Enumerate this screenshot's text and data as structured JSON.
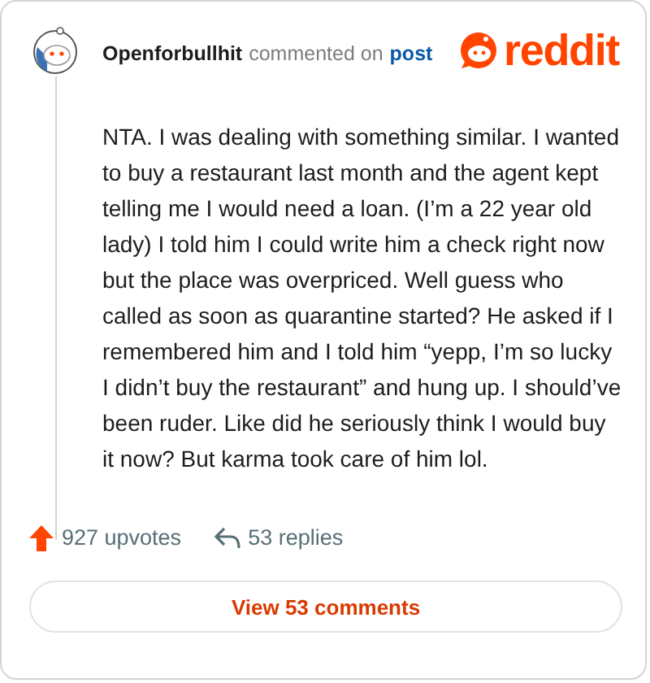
{
  "comment": {
    "author": "Openforbullhit",
    "action": "commented on",
    "target": "post",
    "logo_text": "reddit",
    "body": "NTA. I was dealing with something similar. I wanted to buy a restaurant last month and the agent kept telling me I would need a loan. (I’m a 22 year old lady) I told him I could write him a check right now but the place was overpriced. Well guess who called as soon as quarantine started? He asked if I remembered him and I told him “yepp, I’m so lucky I didn’t buy the restaurant” and hung up. I should’ve been ruder. Like did he seriously think I would buy it now? But karma took care of him lol.",
    "upvotes": "927 upvotes",
    "replies": "53 replies",
    "view_button": "View 53 comments"
  }
}
